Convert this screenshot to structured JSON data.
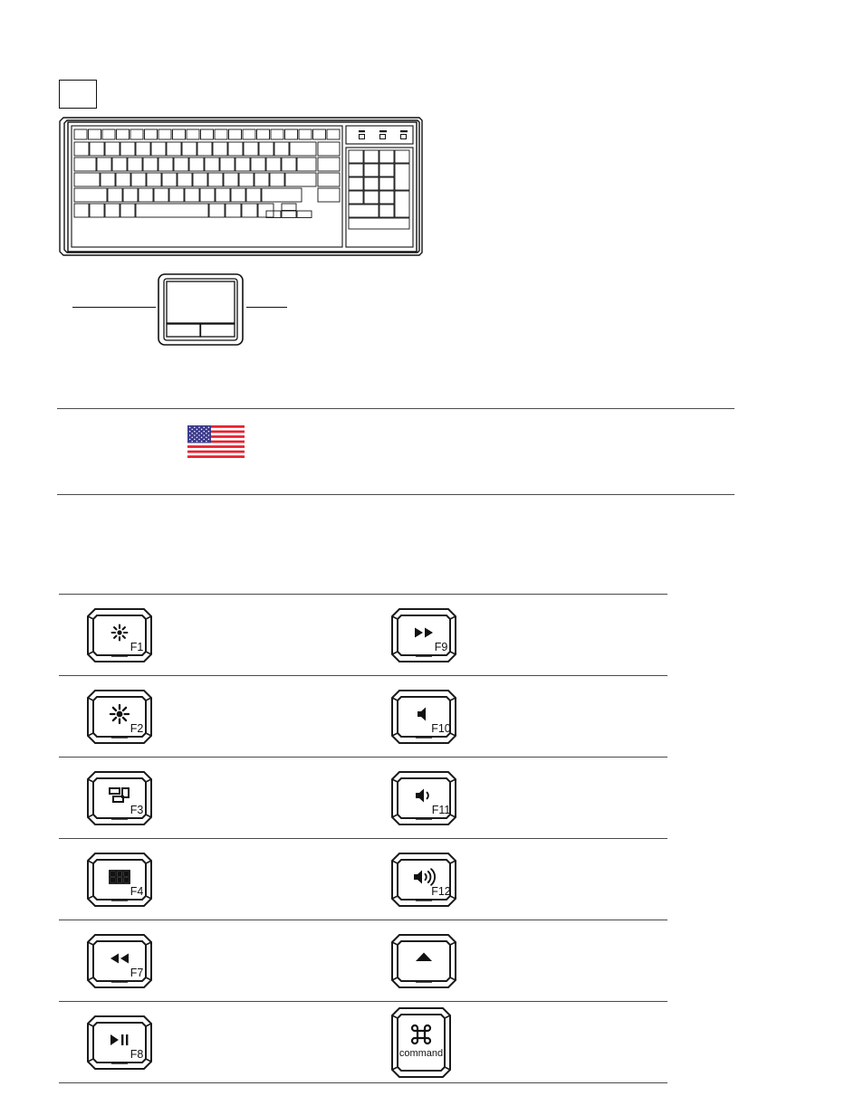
{
  "document": {
    "figures": {
      "callout_box": {
        "name": "empty-callout-box"
      },
      "keyboard": {
        "name": "keyboard-illustration",
        "indicators": [
          "num-lock-led",
          "caps-lock-led",
          "scroll-lock-led"
        ]
      },
      "touchpad": {
        "name": "touchpad-illustration",
        "leader_lines": [
          "left-leader-line",
          "right-leader-line"
        ]
      },
      "flag": {
        "name": "us-flag",
        "colors": {
          "red": "#e8212f",
          "blue": "#3c3b8c",
          "white": "#ffffff"
        }
      }
    }
  },
  "key_table": {
    "rows": [
      {
        "left": {
          "key": "F1",
          "label": "F1",
          "icon": "brightness-down-icon",
          "glyph": "☀"
        },
        "right": {
          "key": "F9",
          "label": "F9",
          "icon": "fast-forward-icon",
          "glyph": "▶▶"
        }
      },
      {
        "left": {
          "key": "F2",
          "label": "F2",
          "icon": "brightness-up-icon",
          "glyph": "☀"
        },
        "right": {
          "key": "F10",
          "label": "F10",
          "icon": "mute-icon",
          "glyph": "🔇"
        }
      },
      {
        "left": {
          "key": "F3",
          "label": "F3",
          "icon": "expose-icon",
          "glyph": "❐"
        },
        "right": {
          "key": "F11",
          "label": "F11",
          "icon": "volume-down-icon",
          "glyph": "🔉"
        }
      },
      {
        "left": {
          "key": "F4",
          "label": "F4",
          "icon": "dashboard-icon",
          "glyph": "⊞"
        },
        "right": {
          "key": "F12",
          "label": "F12",
          "icon": "volume-up-icon",
          "glyph": "🔊"
        }
      },
      {
        "left": {
          "key": "F7",
          "label": "F7",
          "icon": "rewind-icon",
          "glyph": "◀◀"
        },
        "right": {
          "key": "EJECT",
          "label": "",
          "icon": "eject-icon",
          "glyph": "▲"
        }
      },
      {
        "left": {
          "key": "F8",
          "label": "F8",
          "icon": "play-pause-icon",
          "glyph": "▶❙❙"
        },
        "right": {
          "key": "COMMAND",
          "label": "command",
          "icon": "command-icon",
          "glyph": "⌘"
        }
      }
    ]
  }
}
